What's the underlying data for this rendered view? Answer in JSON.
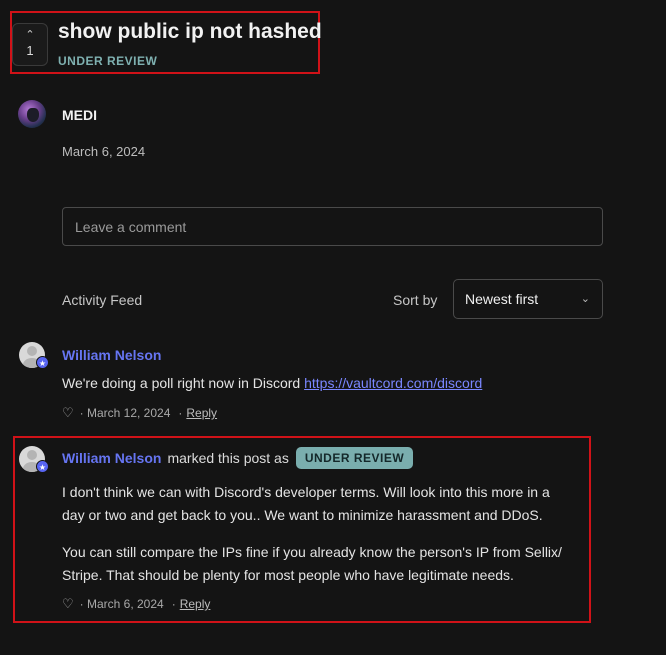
{
  "post": {
    "vote_arrow": "^",
    "vote_count": "1",
    "title": "show public ip not hashed",
    "status": "UNDER REVIEW"
  },
  "author": {
    "name": "MEDI",
    "date": "March 6, 2024"
  },
  "comment_box": {
    "placeholder": "Leave a comment"
  },
  "feed": {
    "label": "Activity Feed",
    "sort_label": "Sort by",
    "sort_value": "Newest first",
    "sort_chevron": "⌄"
  },
  "items": [
    {
      "user": "William Nelson",
      "text_before_link": "We're doing a poll right now in Discord ",
      "link": "https://vaultcord.com/discord",
      "heart": "♡",
      "date": "· March 12, 2024",
      "sep": "·",
      "reply": "Reply"
    },
    {
      "user": "William Nelson",
      "marked": "marked this post as",
      "status": "UNDER REVIEW",
      "para1_line1": "I don't think we can with Discord's developer terms. Will look into this more in a",
      "para1_line2": "day or two and get back to you.. We want to minimize harassment and DDoS.",
      "para2_line1": "You can still compare the IPs fine if you already know the person's IP from Sellix/",
      "para2_line2": "Stripe. That should be plenty for most people who have legitimate needs.",
      "heart": "♡",
      "date": "· March 6, 2024",
      "sep": "·",
      "reply": "Reply"
    }
  ],
  "badge_glyph": "★",
  "colors": {
    "background": "#141414",
    "highlight_border": "#d01218",
    "status_teal": "#7aaeae",
    "username_blue": "#6675f2",
    "link_blue": "#7a87ff"
  }
}
